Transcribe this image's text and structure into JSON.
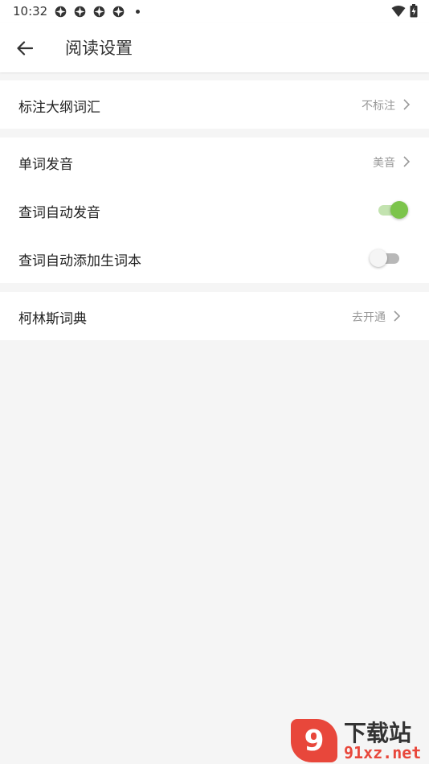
{
  "status_bar": {
    "time": "10:32"
  },
  "app_bar": {
    "title": "阅读设置"
  },
  "groups": [
    {
      "rows": [
        {
          "label": "标注大纲词汇",
          "value": "不标注"
        }
      ]
    },
    {
      "rows": [
        {
          "label": "单词发音",
          "value": "美音"
        },
        {
          "label": "查词自动发音",
          "toggle": true
        },
        {
          "label": "查词自动添加生词本",
          "toggle": false
        }
      ]
    },
    {
      "rows": [
        {
          "label": "柯林斯词典",
          "value": "去开通"
        }
      ]
    }
  ],
  "colors": {
    "accent": "#7cc44c",
    "accent_track": "#c3e3b0",
    "background": "#f5f5f5",
    "watermark": "#e8473b"
  },
  "watermark": {
    "badge": "9",
    "title": "下载站",
    "domain": "91xz.net"
  }
}
